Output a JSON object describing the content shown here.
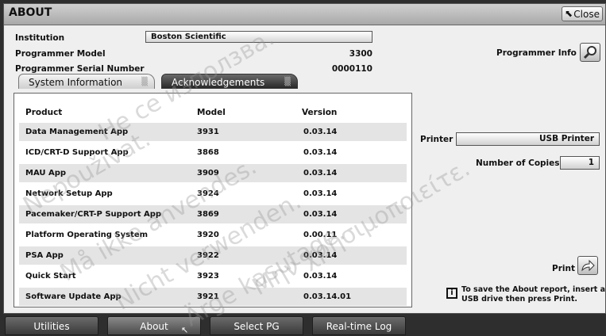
{
  "window": {
    "title": "ABOUT",
    "close_label": "Close"
  },
  "info": {
    "institution_label": "Institution",
    "institution_value": "Boston Scientific",
    "model_label": "Programmer Model",
    "model_value": "3300",
    "serial_label": "Programmer Serial Number",
    "serial_value": "0000110",
    "programmer_info_label": "Programmer Info"
  },
  "tabs": [
    {
      "label": "System Information",
      "active": true
    },
    {
      "label": "Acknowledgements",
      "active": false
    }
  ],
  "table": {
    "headers": [
      "Product",
      "Model",
      "Version"
    ],
    "rows": [
      [
        "Data Management App",
        "3931",
        "0.03.14"
      ],
      [
        "ICD/CRT-D Support App",
        "3868",
        "0.03.14"
      ],
      [
        "MAU App",
        "3909",
        "0.03.14"
      ],
      [
        "Network Setup App",
        "3924",
        "0.03.14"
      ],
      [
        "Pacemaker/CRT-P Support App",
        "3869",
        "0.03.14"
      ],
      [
        "Platform Operating System",
        "3920",
        "0.00.11"
      ],
      [
        "PSA App",
        "3922",
        "0.03.14"
      ],
      [
        "Quick Start",
        "3923",
        "0.03.14"
      ],
      [
        "Software Update App",
        "3921",
        "0.03.14.01"
      ]
    ]
  },
  "printer": {
    "printer_label": "Printer",
    "printer_value": "USB Printer",
    "copies_label": "Number of Copies",
    "copies_value": "1",
    "print_label": "Print",
    "note": "To save the About report, insert a USB drive then press Print."
  },
  "taskbar": [
    "Utilities",
    "About",
    "Select PG",
    "Real-time Log"
  ],
  "watermarks": [
    "Не се използва.",
    "Nepoužívat.",
    "Må ikke anvendes.",
    "Nicht verwenden.",
    "Ärge kasutage.",
    "Μην χρησιμοποιείτε."
  ]
}
